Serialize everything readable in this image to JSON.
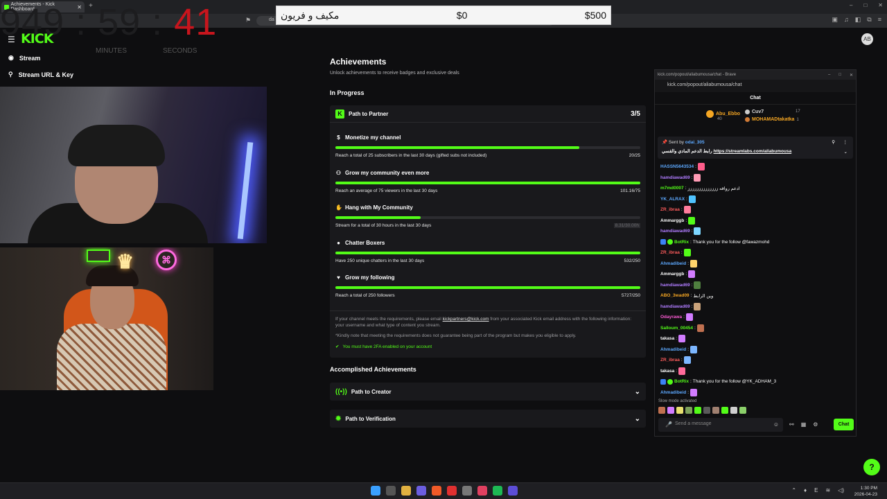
{
  "browser": {
    "tab_title": "Achievements - Kick Dashboard",
    "new_tab": "+",
    "window_controls": [
      "–",
      "□",
      "✕"
    ],
    "url_prefix": "da"
  },
  "timer": {
    "hours_minutes": "949 : 59 : ",
    "seconds": "41",
    "labels": [
      "MINUTES",
      "SECONDS"
    ]
  },
  "donation_bar": {
    "arabic_label": "مكيف و فريون",
    "current": "$0",
    "goal": "$500"
  },
  "dashboard": {
    "logo": "KICK",
    "sidebar": [
      {
        "label": "Stream",
        "icon": "stream-icon"
      },
      {
        "label": "Stream URL & Key",
        "icon": "key-icon"
      }
    ],
    "avatar_text": "AB"
  },
  "achievements": {
    "title": "Achievements",
    "subtitle": "Unlock achievements to receive badges and exclusive deals",
    "in_progress_heading": "In Progress",
    "partner": {
      "title": "Path to Partner",
      "count": "3/5",
      "requirements": [
        {
          "title": "Monetize my channel",
          "desc": "Reach a total of 25 subscribers in the last 30 days (gifted subs not included)",
          "value": "20/25",
          "progress": 0.8,
          "muted": false,
          "icon": "dollar-icon"
        },
        {
          "title": "Grow my community even more",
          "desc": "Reach an average of 75 viewers in the last 30 days",
          "value": "101.16/75",
          "progress": 1.0,
          "muted": false,
          "icon": "community-icon"
        },
        {
          "title": "Hang with My Community",
          "desc": "Stream for a total of 30 hours in the last 30 days",
          "value": "8.31/30.00h",
          "progress": 0.277,
          "muted": true,
          "icon": "hang-icon"
        },
        {
          "title": "Chatter Boxers",
          "desc": "Have 250 unique chatters in the last 30 days",
          "value": "532/250",
          "progress": 1.0,
          "muted": false,
          "icon": "chat-bubble-icon"
        },
        {
          "title": "Grow my following",
          "desc": "Reach a total of 250 followers",
          "value": "5727/250",
          "progress": 1.0,
          "muted": false,
          "icon": "heart-icon"
        }
      ],
      "note_before_link": "If your channel meets the requirements, please email ",
      "note_link": "kickpartners@kick.com",
      "note_after_link": " from your associated Kick email address with the following information: your username and what type of content you stream.",
      "note_2": "*Kindly note that meeting the requirements does not guarantee being part of the program but makes you eligible to apply.",
      "twofa": "You must have 2FA enabled on your account"
    },
    "accomplished_heading": "Accomplished Achievements",
    "accomplished": [
      {
        "title": "Path to Creator",
        "icon": "broadcast-icon"
      },
      {
        "title": "Path to Verification",
        "icon": "verified-icon"
      }
    ]
  },
  "chat_window": {
    "title": "kick.com/popout/aliabumousa/chat - Brave",
    "url": "kick.com/popout/aliabumousa/chat",
    "heading": "Chat",
    "top_gifters": [
      {
        "name": "Abu_Ebbo",
        "count": "40"
      },
      {
        "name": "Cuv7",
        "count": "17"
      },
      {
        "name": "MOHAMADtakatka",
        "count": "1"
      }
    ],
    "pinned": {
      "sent_by_label": "Sent by",
      "sent_by_user": "odai_305",
      "message_text": "رابط الدعم المادي والقسي ",
      "message_link": "https://streamlabs.com/aliabumousa"
    },
    "messages": [
      {
        "user": "HASSN5643534",
        "color": "#5da9ff",
        "text": "",
        "emote": "#ff5c8a",
        "badges": []
      },
      {
        "user": "hamdiawad69",
        "color": "#b07cff",
        "text": "",
        "emote": "#ff9bb5",
        "badges": []
      },
      {
        "user": "m7md0007",
        "color": "#53fc18",
        "text": "ادعم رواقه زززززززززززززز",
        "emote": "",
        "badges": []
      },
      {
        "user": "YK_ALRAX",
        "color": "#5da9ff",
        "text": "",
        "emote": "#4fc3ff",
        "badges": []
      },
      {
        "user": "ZR_ibraa",
        "color": "#ff5c5c",
        "text": "",
        "emote": "#ff7c9c",
        "badges": []
      },
      {
        "user": "Ammarggb",
        "color": "#ffffff",
        "text": "",
        "emote": "#53fc18",
        "badges": []
      },
      {
        "user": "hamdiawad69",
        "color": "#b07cff",
        "text": "",
        "emote": "#7cd6ff",
        "badges": []
      },
      {
        "user": "BotRix",
        "color": "#53fc18",
        "text": "Thank you for the follow @fawazmohd",
        "emote": "",
        "badges": [
          "bot",
          "verified"
        ]
      },
      {
        "user": "ZR_ibraa",
        "color": "#ff5c5c",
        "text": "",
        "emote": "#53fc18",
        "badges": []
      },
      {
        "user": "Ahmadibeid",
        "color": "#5da9ff",
        "text": "",
        "emote": "#ffd36b",
        "badges": []
      },
      {
        "user": "Ammarggb",
        "color": "#ffffff",
        "text": "",
        "emote": "#d27cff",
        "badges": []
      },
      {
        "user": "hamdiawad69",
        "color": "#b07cff",
        "text": "",
        "emote": "#4f7f3f",
        "badges": []
      },
      {
        "user": "ABO_3wad09",
        "color": "#f5a623",
        "text": "وين الرابط",
        "emote": "",
        "badges": []
      },
      {
        "user": "hamdiawad69",
        "color": "#b07cff",
        "text": "",
        "emote": "#c9a27a",
        "badges": []
      },
      {
        "user": "Odayrawa",
        "color": "#ff5cd6",
        "text": "",
        "emote": "#d27cff",
        "badges": []
      },
      {
        "user": "Salloum_00454",
        "color": "#53fc18",
        "text": "",
        "emote": "#c07050",
        "badges": []
      },
      {
        "user": "takasa",
        "color": "#ffffff",
        "text": "",
        "emote": "#d27cff",
        "badges": []
      },
      {
        "user": "Ahmadibeid",
        "color": "#5da9ff",
        "text": "",
        "emote": "#7cb6ff",
        "badges": []
      },
      {
        "user": "ZR_ibraa",
        "color": "#ff5c5c",
        "text": "",
        "emote": "#7cb6ff",
        "badges": []
      },
      {
        "user": "takasa",
        "color": "#ffffff",
        "text": "",
        "emote": "#ff6b9a",
        "badges": []
      },
      {
        "user": "BotRix",
        "color": "#53fc18",
        "text": "Thank you for the follow @YK_ADHAM_3",
        "emote": "",
        "badges": [
          "bot",
          "verified"
        ]
      },
      {
        "user": "Ahmadibeid",
        "color": "#5da9ff",
        "text": "",
        "emote": "#d27cff",
        "badges": []
      }
    ],
    "slow_mode": "Slow mode activated",
    "input_placeholder": "Send a message",
    "send_label": "Chat"
  },
  "taskbar": {
    "time": "1:30 PM",
    "date": "2026-04-23",
    "lang": "E"
  }
}
